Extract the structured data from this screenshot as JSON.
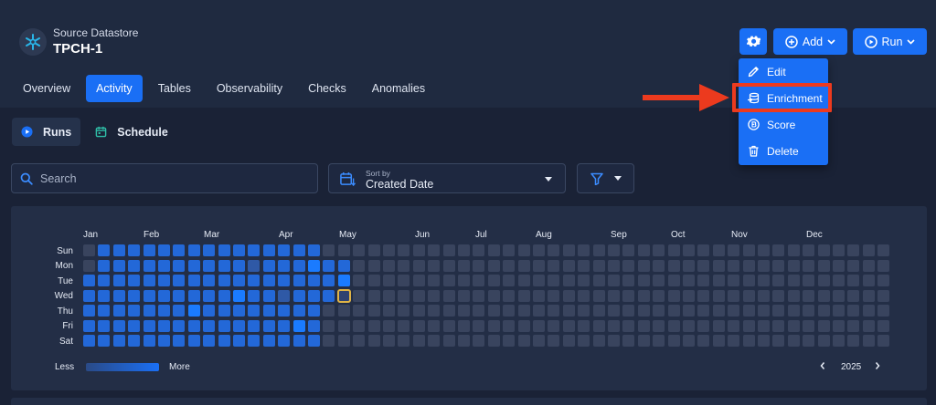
{
  "datastore": {
    "type_label": "Source Datastore",
    "name": "TPCH-1",
    "logo_icon": "snowflake-icon"
  },
  "tabs": [
    {
      "label": "Overview",
      "active": false
    },
    {
      "label": "Activity",
      "active": true
    },
    {
      "label": "Tables",
      "active": false
    },
    {
      "label": "Observability",
      "active": false
    },
    {
      "label": "Checks",
      "active": false
    },
    {
      "label": "Anomalies",
      "active": false
    }
  ],
  "header_actions": {
    "settings_icon": "gear-icon",
    "add_label": "Add",
    "run_label": "Run"
  },
  "add_menu": {
    "items": [
      {
        "label": "Edit",
        "icon": "pencil-icon"
      },
      {
        "label": "Enrichment",
        "icon": "database-arrow-icon",
        "highlighted": true
      },
      {
        "label": "Score",
        "icon": "score-icon"
      },
      {
        "label": "Delete",
        "icon": "trash-icon"
      }
    ]
  },
  "subtabs": [
    {
      "label": "Runs",
      "icon": "play-circle-icon",
      "active": true
    },
    {
      "label": "Schedule",
      "icon": "calendar-icon",
      "active": false
    }
  ],
  "search": {
    "placeholder": "Search",
    "value": ""
  },
  "sort": {
    "caption": "Sort by",
    "value": "Created Date"
  },
  "filter": {
    "icon": "filter-icon"
  },
  "heatmap": {
    "months": [
      "Jan",
      "Feb",
      "Mar",
      "Apr",
      "May",
      "Jun",
      "Jul",
      "Aug",
      "Sep",
      "Oct",
      "Nov",
      "Dec"
    ],
    "days": [
      "Sun",
      "Mon",
      "Tue",
      "Wed",
      "Thu",
      "Fri",
      "Sat"
    ],
    "legend_less": "Less",
    "legend_more": "More",
    "year": "2025",
    "colors": {
      "empty": "#39445e",
      "low": "#2f59a6",
      "mid": "#2368d8",
      "high": "#1a7bff",
      "selected_border": "#e0b446"
    },
    "levels": [
      [
        0,
        2,
        2,
        2,
        2,
        2,
        2,
        2,
        2,
        2,
        2,
        2,
        2,
        2,
        2,
        2,
        0,
        0,
        0,
        0,
        0,
        0,
        0,
        0,
        0,
        0,
        0,
        0,
        0,
        0,
        0,
        0,
        0,
        0,
        0,
        0,
        0,
        0,
        0,
        0,
        0,
        0,
        0,
        0,
        0,
        0,
        0,
        0,
        0,
        0,
        0,
        0,
        0,
        0
      ],
      [
        0,
        2,
        2,
        2,
        2,
        2,
        2,
        2,
        2,
        2,
        2,
        1,
        2,
        2,
        2,
        3,
        2,
        2,
        0,
        0,
        0,
        0,
        0,
        0,
        0,
        0,
        0,
        0,
        0,
        0,
        0,
        0,
        0,
        0,
        0,
        0,
        0,
        0,
        0,
        0,
        0,
        0,
        0,
        0,
        0,
        0,
        0,
        0,
        0,
        0,
        0,
        0,
        0,
        0
      ],
      [
        2,
        2,
        2,
        2,
        2,
        2,
        2,
        2,
        2,
        2,
        2,
        2,
        2,
        2,
        2,
        2,
        2,
        3,
        0,
        0,
        0,
        0,
        0,
        0,
        0,
        0,
        0,
        0,
        0,
        0,
        0,
        0,
        0,
        0,
        0,
        0,
        0,
        0,
        0,
        0,
        0,
        0,
        0,
        0,
        0,
        0,
        0,
        0,
        0,
        0,
        0,
        0,
        0,
        0
      ],
      [
        2,
        2,
        2,
        2,
        2,
        2,
        2,
        2,
        2,
        2,
        3,
        2,
        2,
        1,
        2,
        2,
        2,
        0,
        0,
        0,
        0,
        0,
        0,
        0,
        0,
        0,
        0,
        0,
        0,
        0,
        0,
        0,
        0,
        0,
        0,
        0,
        0,
        0,
        0,
        0,
        0,
        0,
        0,
        0,
        0,
        0,
        0,
        0,
        0,
        0,
        0,
        0,
        0,
        0
      ],
      [
        2,
        2,
        2,
        2,
        2,
        2,
        2,
        3,
        2,
        2,
        2,
        2,
        2,
        2,
        2,
        2,
        0,
        0,
        0,
        0,
        0,
        0,
        0,
        0,
        0,
        0,
        0,
        0,
        0,
        0,
        0,
        0,
        0,
        0,
        0,
        0,
        0,
        0,
        0,
        0,
        0,
        0,
        0,
        0,
        0,
        0,
        0,
        0,
        0,
        0,
        0,
        0,
        0,
        0
      ],
      [
        2,
        2,
        2,
        2,
        2,
        2,
        2,
        2,
        2,
        2,
        2,
        2,
        2,
        2,
        3,
        2,
        0,
        0,
        0,
        0,
        0,
        0,
        0,
        0,
        0,
        0,
        0,
        0,
        0,
        0,
        0,
        0,
        0,
        0,
        0,
        0,
        0,
        0,
        0,
        0,
        0,
        0,
        0,
        0,
        0,
        0,
        0,
        0,
        0,
        0,
        0,
        0,
        0,
        0
      ],
      [
        2,
        2,
        2,
        2,
        2,
        2,
        2,
        2,
        2,
        2,
        2,
        2,
        2,
        2,
        2,
        2,
        0,
        0,
        0,
        0,
        0,
        0,
        0,
        0,
        0,
        0,
        0,
        0,
        0,
        0,
        0,
        0,
        0,
        0,
        0,
        0,
        0,
        0,
        0,
        0,
        0,
        0,
        0,
        0,
        0,
        0,
        0,
        0,
        0,
        0,
        0,
        0,
        0,
        0
      ]
    ],
    "selected_cell": {
      "day": "Wed",
      "week": 17
    }
  }
}
